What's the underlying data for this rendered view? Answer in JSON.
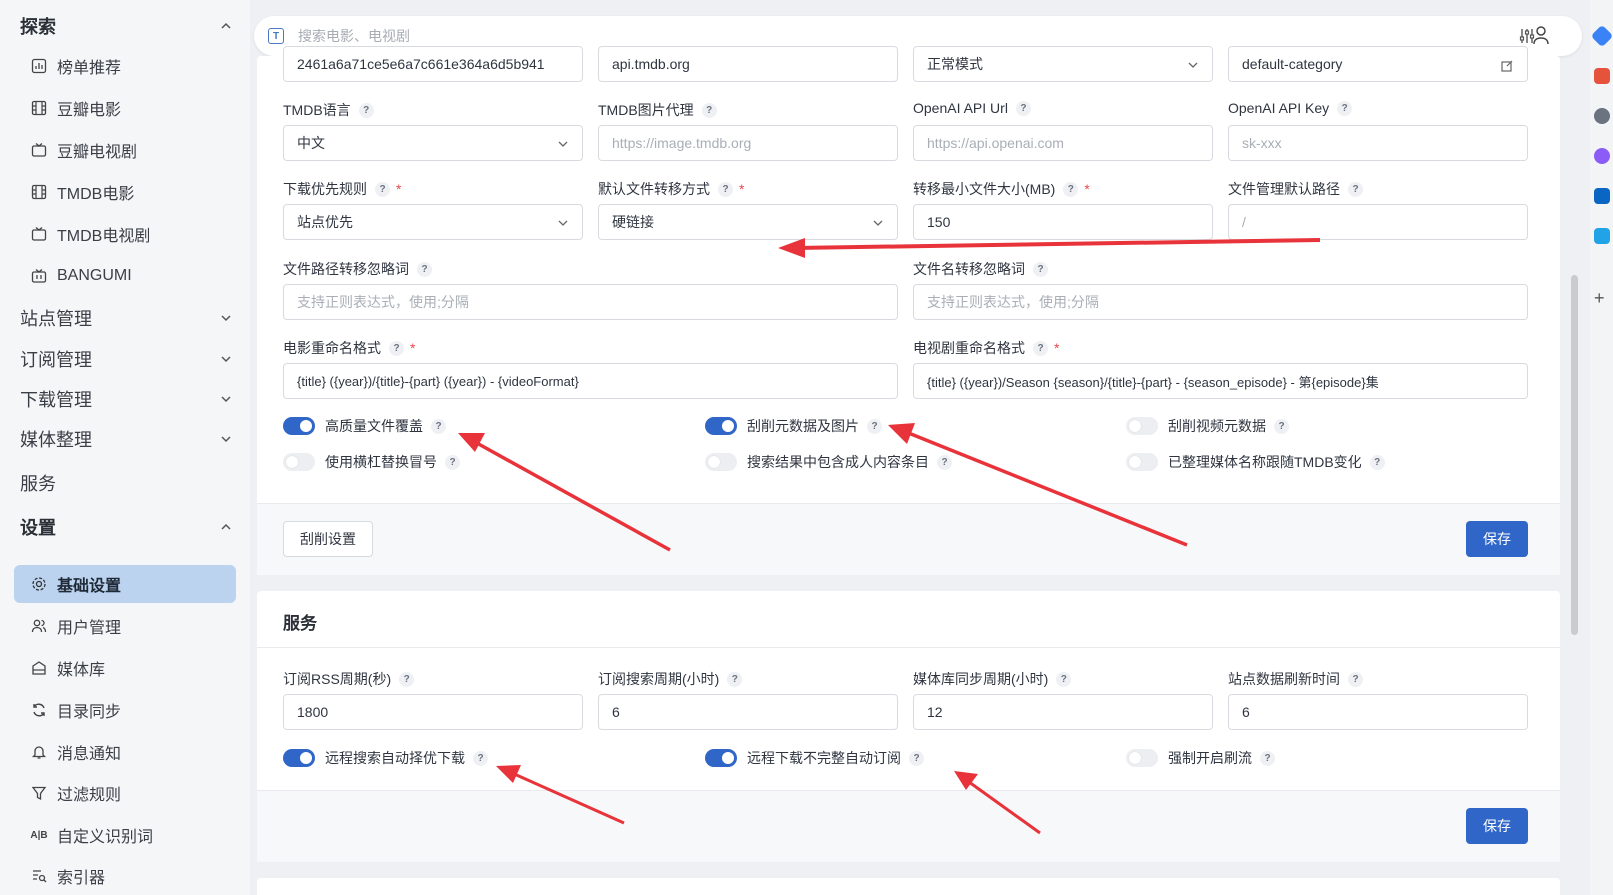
{
  "sidebar": {
    "explore": "探索",
    "explore_items": [
      "榜单推荐",
      "豆瓣电影",
      "豆瓣电视剧",
      "TMDB电影",
      "TMDB电视剧",
      "BANGUMI"
    ],
    "groups": [
      "站点管理",
      "订阅管理",
      "下载管理",
      "媒体整理"
    ],
    "service": "服务",
    "settings": "设置",
    "settings_items": [
      "基础设置",
      "用户管理",
      "媒体库",
      "目录同步",
      "消息通知",
      "过滤规则",
      "自定义识别词",
      "索引器"
    ]
  },
  "search": {
    "placeholder": "搜索电影、电视剧"
  },
  "top_row": {
    "values": [
      "2461a6a71ce5e6a7c661e364a6d5b941",
      "api.tmdb.org",
      "正常模式",
      "default-category"
    ]
  },
  "basic": {
    "tmdb_lang": {
      "label": "TMDB语言",
      "value": "中文"
    },
    "tmdb_img_proxy": {
      "label": "TMDB图片代理",
      "placeholder": "https://image.tmdb.org"
    },
    "openai_url": {
      "label": "OpenAI API Url",
      "placeholder": "https://api.openai.com"
    },
    "openai_key": {
      "label": "OpenAI API Key",
      "placeholder": "sk-xxx"
    },
    "dl_priority": {
      "label": "下载优先规则",
      "value": "站点优先"
    },
    "transfer_mode": {
      "label": "默认文件转移方式",
      "value": "硬链接"
    },
    "min_size": {
      "label": "转移最小文件大小(MB)",
      "value": "150"
    },
    "file_default_path": {
      "label": "文件管理默认路径",
      "placeholder": "/"
    },
    "path_ignore": {
      "label": "文件路径转移忽略词",
      "placeholder": "支持正则表达式，使用;分隔"
    },
    "name_ignore": {
      "label": "文件名转移忽略词",
      "placeholder": "支持正则表达式，使用;分隔"
    },
    "movie_fmt": {
      "label": "电影重命名格式",
      "value": "{title} ({year})/{title}-{part} ({year}) - {videoFormat}"
    },
    "tv_fmt": {
      "label": "电视剧重命名格式",
      "value": "{title} ({year})/Season {season}/{title}-{part} - {season_episode} - 第{episode}集"
    },
    "toggles": [
      {
        "label": "高质量文件覆盖",
        "on": true
      },
      {
        "label": "刮削元数据及图片",
        "on": true
      },
      {
        "label": "刮削视频元数据",
        "on": false
      },
      {
        "label": "使用横杠替换冒号",
        "on": false
      },
      {
        "label": "搜索结果中包含成人内容条目",
        "on": false
      },
      {
        "label": "已整理媒体名称跟随TMDB变化",
        "on": false
      }
    ],
    "scrape_btn": "刮削设置",
    "save": "保存"
  },
  "service": {
    "title": "服务",
    "rss": {
      "label": "订阅RSS周期(秒)",
      "value": "1800"
    },
    "search_period": {
      "label": "订阅搜索周期(小时)",
      "value": "6"
    },
    "lib_sync": {
      "label": "媒体库同步周期(小时)",
      "value": "12"
    },
    "site_refresh": {
      "label": "站点数据刷新时间",
      "value": "6"
    },
    "toggles": [
      {
        "label": "远程搜索自动择优下载",
        "on": true
      },
      {
        "label": "远程下载不完整自动订阅",
        "on": true
      },
      {
        "label": "强制开启刷流",
        "on": false
      }
    ],
    "save": "保存"
  },
  "theme": {
    "accent": "#2f66c7",
    "active_nav": "#bcd3ef",
    "annotation": "#e8333a"
  }
}
